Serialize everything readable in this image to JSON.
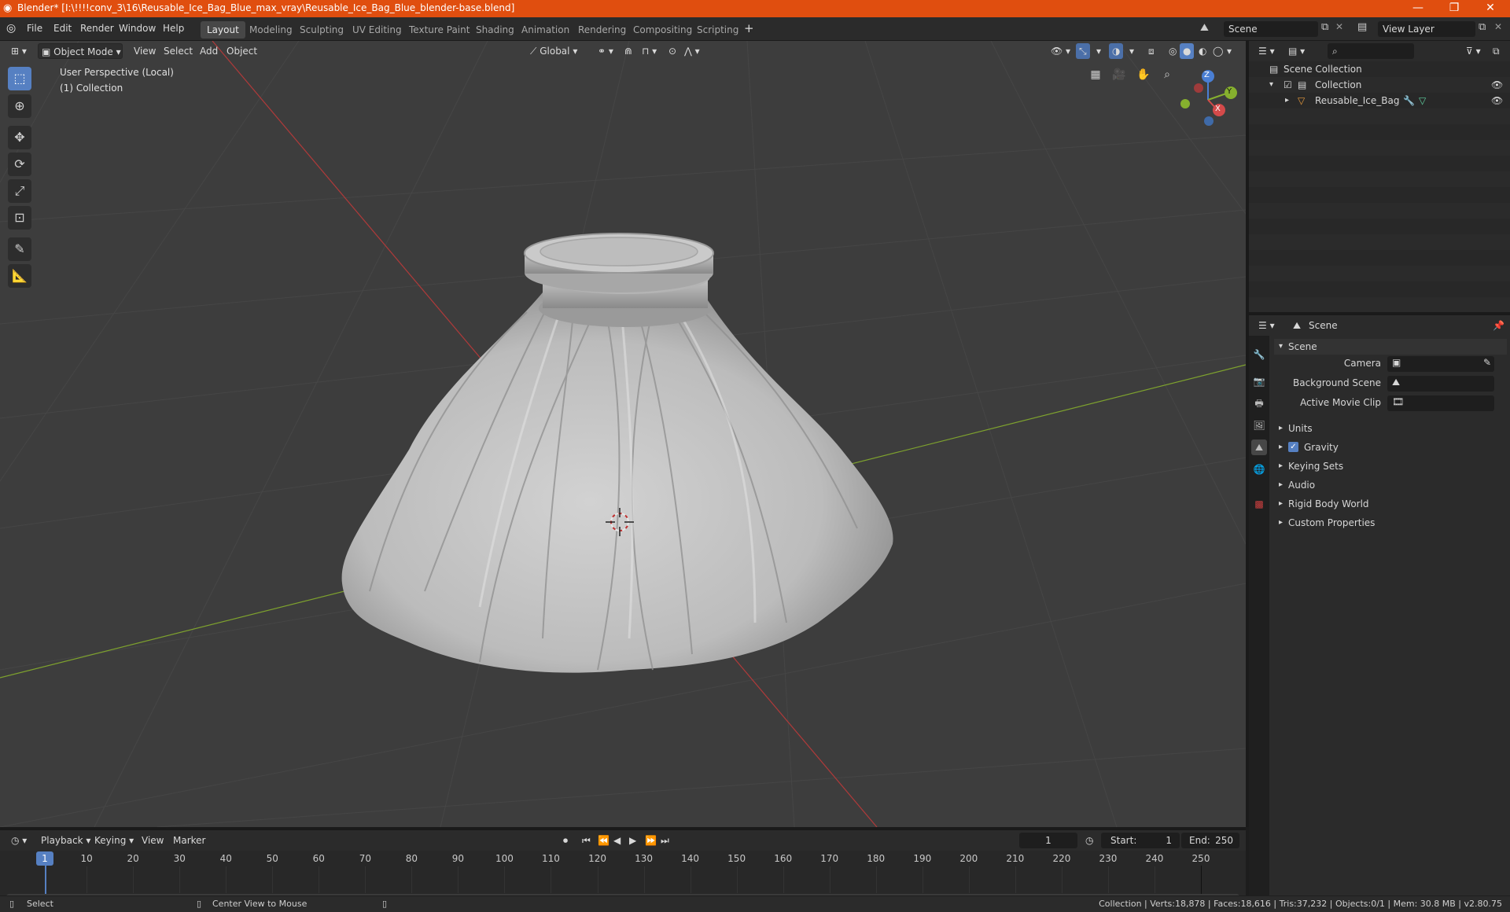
{
  "window": {
    "title": "Blender* [I:\\!!!!conv_3\\16\\Reusable_Ice_Bag_Blue_max_vray\\Reusable_Ice_Bag_Blue_blender-base.blend]",
    "minimize": "—",
    "restore": "❐",
    "close": "✕"
  },
  "menu": {
    "items": [
      "File",
      "Edit",
      "Render",
      "Window",
      "Help"
    ],
    "workspaces": [
      "Layout",
      "Modeling",
      "Sculpting",
      "UV Editing",
      "Texture Paint",
      "Shading",
      "Animation",
      "Rendering",
      "Compositing",
      "Scripting"
    ],
    "add_tab": "+",
    "scene_name": "Scene",
    "view_layer": "View Layer"
  },
  "viewport": {
    "mode": "Object Mode",
    "menus": [
      "View",
      "Select",
      "Add",
      "Object"
    ],
    "orientation": "Global",
    "overlay_line1": "User Perspective (Local)",
    "overlay_line2": "(1) Collection",
    "gizmo": {
      "z": "Z",
      "y": "Y",
      "x": "X"
    }
  },
  "outliner": {
    "search_placeholder": "",
    "root": "Scene Collection",
    "collection": "Collection",
    "object": "Reusable_Ice_Bag"
  },
  "properties": {
    "context": "Scene",
    "panel_title": "Scene",
    "fields": [
      {
        "label": "Camera"
      },
      {
        "label": "Background Scene"
      },
      {
        "label": "Active Movie Clip"
      }
    ],
    "sections": [
      "Units",
      "Gravity",
      "Keying Sets",
      "Audio",
      "Rigid Body World",
      "Custom Properties"
    ],
    "gravity_checked": true
  },
  "timeline": {
    "menus": [
      "Playback",
      "Keying",
      "View",
      "Marker"
    ],
    "current_frame": "1",
    "start_label": "Start:",
    "start": "1",
    "end_label": "End:",
    "end": "250",
    "ticks": [
      "10",
      "20",
      "30",
      "40",
      "50",
      "60",
      "70",
      "80",
      "90",
      "100",
      "110",
      "120",
      "130",
      "140",
      "150",
      "160",
      "170",
      "180",
      "190",
      "200",
      "210",
      "220",
      "230",
      "240",
      "250"
    ],
    "playhead": "1"
  },
  "status": {
    "left": "Select",
    "middle": "Center View to Mouse",
    "right": "Collection | Verts:18,878 | Faces:18,616 | Tris:37,232 | Objects:0/1 | Mem: 30.8 MB | v2.80.75"
  },
  "colors": {
    "title_bar": "#e04e0f",
    "active_tool": "#5680c2",
    "viewport_bg": "#3d3d3d",
    "x_axis": "#d44a4a",
    "y_axis": "#86b02e",
    "z_axis": "#4a7fd4"
  }
}
